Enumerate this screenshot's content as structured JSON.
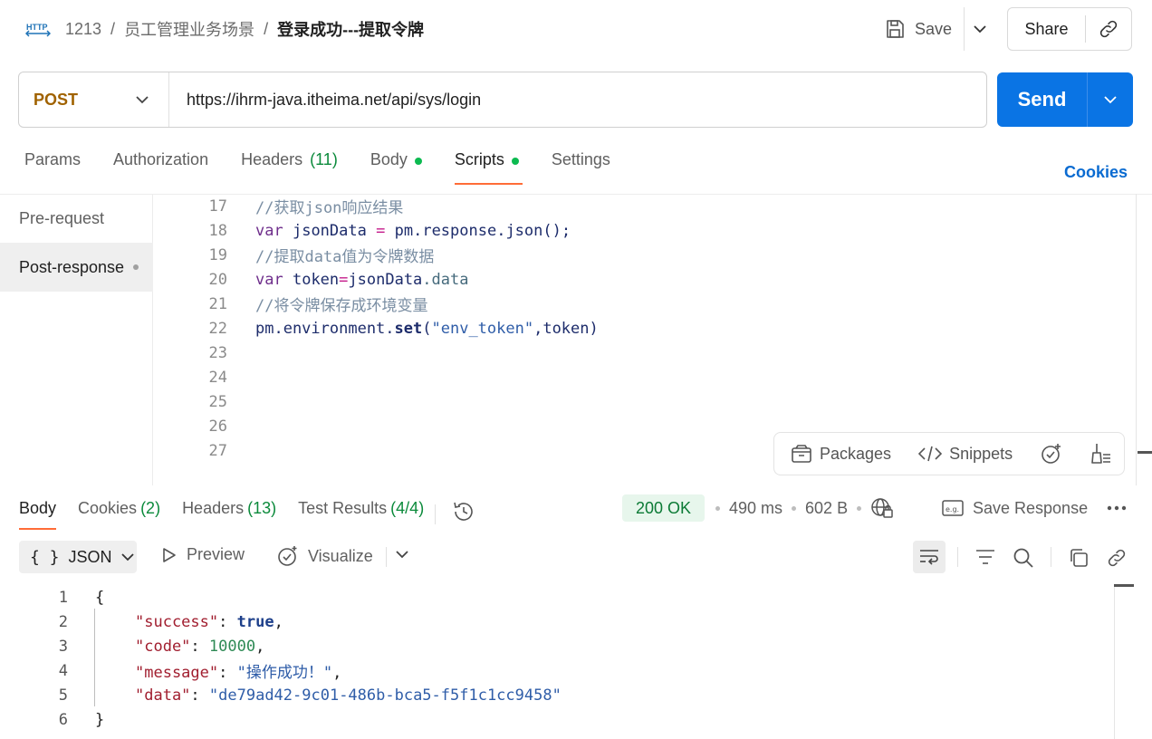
{
  "header": {
    "breadcrumb": [
      "1213",
      "员工管理业务场景",
      "登录成功---提取令牌"
    ],
    "save_label": "Save",
    "share_label": "Share"
  },
  "request": {
    "method": "POST",
    "url": "https://ihrm-java.itheima.net/api/sys/login",
    "send_label": "Send"
  },
  "request_tabs": [
    {
      "label": "Params",
      "count": ""
    },
    {
      "label": "Authorization",
      "count": ""
    },
    {
      "label": "Headers",
      "count": "(11)"
    },
    {
      "label": "Body",
      "count": ""
    },
    {
      "label": "Scripts",
      "count": ""
    },
    {
      "label": "Settings",
      "count": ""
    }
  ],
  "cookies_label": "Cookies",
  "scripts": {
    "side_items": [
      "Pre-request",
      "Post-response"
    ],
    "line_numbers": [
      "17",
      "18",
      "19",
      "20",
      "21",
      "22",
      "23",
      "24",
      "25",
      "26",
      "27"
    ],
    "code": {
      "l17": "//获取json响应结果",
      "l18_kw": "var",
      "l18_var": "jsonData",
      "l18_op": "=",
      "l18_rest1": "pm",
      "l18_rest2": ".response.json();",
      "l19": "//提取data值为令牌数据",
      "l20_kw": "var",
      "l20_var": "token",
      "l20_op": "=",
      "l20_obj": "jsonData",
      "l20_prop": ".data",
      "l21": "//将令牌保存成环境变量",
      "l22_a": "pm.environment.",
      "l22_fn": "set",
      "l22_b": "(",
      "l22_str": "\"env_token\"",
      "l22_c": ",token)"
    },
    "tools": {
      "packages": "Packages",
      "snippets": "Snippets"
    }
  },
  "response": {
    "tabs": [
      {
        "label": "Body",
        "count": ""
      },
      {
        "label": "Cookies",
        "count": "(2)"
      },
      {
        "label": "Headers",
        "count": "(13)"
      },
      {
        "label": "Test Results",
        "count": "(4/4)"
      }
    ],
    "status": "200 OK",
    "time": "490 ms",
    "size": "602 B",
    "save_response_label": "Save Response",
    "format": "JSON",
    "preview_label": "Preview",
    "visualize_label": "Visualize",
    "line_numbers": [
      "1",
      "2",
      "3",
      "4",
      "5",
      "6"
    ],
    "body": {
      "open": "{",
      "k1": "\"success\"",
      "v1": "true",
      "k2": "\"code\"",
      "v2": "10000",
      "k3": "\"message\"",
      "v3": "\"操作成功！\"",
      "k4": "\"data\"",
      "v4": "\"de79ad42-9c01-486b-bca5-f5f1c1cc9458\"",
      "close": "}"
    }
  },
  "colors": {
    "accent": "#ff6c37",
    "send": "#0a74e4",
    "success": "#0b7a35",
    "method": "#a06200"
  }
}
